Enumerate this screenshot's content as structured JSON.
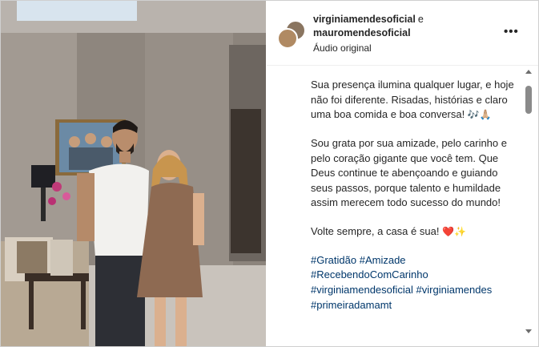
{
  "post": {
    "authors": [
      {
        "username": "virginiamendesoficial"
      },
      {
        "username": "mauromendesoficial"
      }
    ],
    "joiner": "e",
    "audio_label": "Áudio original",
    "more_icon": "more-horizontal-icon",
    "caption": {
      "paragraph1": "Sua presença ilumina qualquer lugar, e hoje não foi diferente. Risadas, histórias e claro uma boa comida e boa conversa!",
      "paragraph1_emojis": "🎶🙏🏼",
      "paragraph2": "Sou grata por sua amizade, pelo carinho e pelo coração gigante que você tem. Que Deus continue te abençoando e guiando seus passos, porque talento e humildade assim merecem todo sucesso do mundo!",
      "paragraph3": "Volte sempre, a casa é sua!",
      "paragraph3_emojis": "❤️✨",
      "hashtags": [
        "#Gratidão",
        "#Amizade",
        "#RecebendoComCarinho",
        "#virginiamendesoficial",
        "#virginiamendes",
        "#primeiradamamt"
      ]
    }
  },
  "colors": {
    "text": "#262626",
    "hashtag": "#00376b",
    "border": "#efefef"
  }
}
